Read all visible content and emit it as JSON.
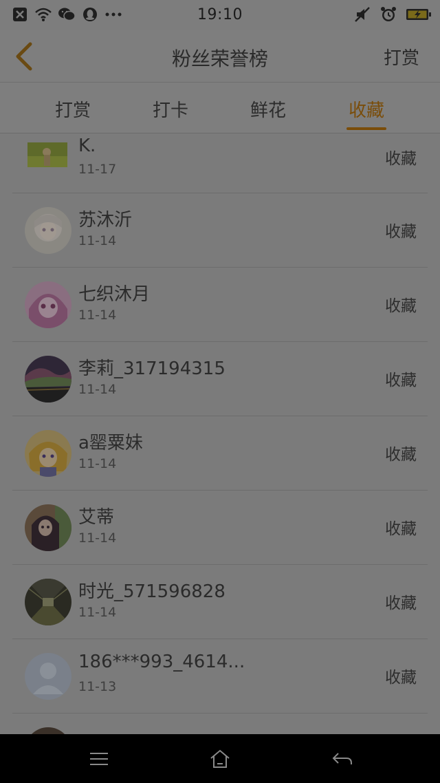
{
  "status_bar": {
    "time": "19:10",
    "left_icons": [
      "close-box-icon",
      "wifi-icon",
      "wechat-icon",
      "qq-icon",
      "more-dots-icon"
    ],
    "right_icons": [
      "mute-icon",
      "alarm-icon",
      "battery-charging-icon"
    ]
  },
  "header": {
    "title": "粉丝荣誉榜",
    "action_label": "打赏"
  },
  "tabs": [
    {
      "label": "打赏"
    },
    {
      "label": "打卡"
    },
    {
      "label": "鲜花"
    },
    {
      "label": "收藏"
    }
  ],
  "active_tab": "收藏",
  "colors": {
    "accent": "#7a4d0a",
    "overlay": "#7c7c7c"
  },
  "list": [
    {
      "name": "K.",
      "date": "11-17",
      "action": "收藏",
      "avatar": "landscape-photo"
    },
    {
      "name": "苏沐沂",
      "date": "11-14",
      "action": "收藏",
      "avatar": "anime-girl-white"
    },
    {
      "name": "七织沐月",
      "date": "11-14",
      "action": "收藏",
      "avatar": "anime-girl-pink"
    },
    {
      "name": "李莉_317194315",
      "date": "11-14",
      "action": "收藏",
      "avatar": "aurora-photo"
    },
    {
      "name": "a罂粟妹",
      "date": "11-14",
      "action": "收藏",
      "avatar": "anime-girl-yellow"
    },
    {
      "name": "艾蒂",
      "date": "11-14",
      "action": "收藏",
      "avatar": "anime-girl-dark"
    },
    {
      "name": "时光_571596828",
      "date": "11-14",
      "action": "收藏",
      "avatar": "tunnel-photo"
    },
    {
      "name": "186***993_4614...",
      "date": "11-13",
      "action": "收藏",
      "avatar": "default-user"
    }
  ]
}
